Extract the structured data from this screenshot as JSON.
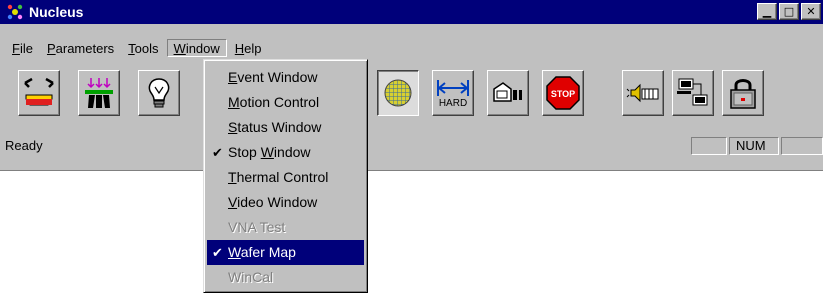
{
  "window": {
    "title": "Nucleus",
    "caption_buttons": [
      {
        "name": "minimize",
        "glyph": "▁"
      },
      {
        "name": "maximize",
        "glyph": "□"
      },
      {
        "name": "close",
        "glyph": "✕"
      }
    ]
  },
  "menubar": {
    "items": [
      {
        "pre": "",
        "mnem": "F",
        "post": "ile"
      },
      {
        "pre": "",
        "mnem": "P",
        "post": "arameters"
      },
      {
        "pre": "",
        "mnem": "T",
        "post": "ools"
      },
      {
        "pre": "",
        "mnem": "W",
        "post": "indow"
      },
      {
        "pre": "",
        "mnem": "H",
        "post": "elp"
      }
    ]
  },
  "window_menu": {
    "items": [
      {
        "pre": "",
        "mnem": "E",
        "post": "vent Window",
        "checked": false,
        "disabled": false
      },
      {
        "pre": "",
        "mnem": "M",
        "post": "otion Control",
        "checked": false,
        "disabled": false
      },
      {
        "pre": "",
        "mnem": "S",
        "post": "tatus Window",
        "checked": false,
        "disabled": false
      },
      {
        "pre": "Stop ",
        "mnem": "W",
        "post": "indow",
        "checked": true,
        "disabled": false
      },
      {
        "pre": "",
        "mnem": "T",
        "post": "hermal Control",
        "checked": false,
        "disabled": false
      },
      {
        "pre": "",
        "mnem": "V",
        "post": "ideo Window",
        "checked": false,
        "disabled": false
      },
      {
        "pre": "VNA Test",
        "mnem": "",
        "post": "",
        "checked": false,
        "disabled": true
      },
      {
        "pre": "",
        "mnem": "W",
        "post": "afer Map",
        "checked": true,
        "disabled": false,
        "selected": true
      },
      {
        "pre": "WinCal",
        "mnem": "",
        "post": "",
        "checked": false,
        "disabled": true
      }
    ],
    "check_glyph": "✔"
  },
  "toolbar": {
    "hard_label": "HARD",
    "stop_label": "STOP",
    "icons": [
      "chuck-icon",
      "probe-pins-icon",
      "light-bulb-icon",
      "wafer-map-icon",
      "hard-limit-icon",
      "camera-icon",
      "stop-sign-icon",
      "speaker-icon",
      "network-icon",
      "lock-icon"
    ]
  },
  "statusbar": {
    "text": "Ready",
    "num_label": "NUM"
  },
  "colors": {
    "titlebar": "#00007a",
    "face": "#c0c0c0",
    "highlight": "#00007a"
  }
}
